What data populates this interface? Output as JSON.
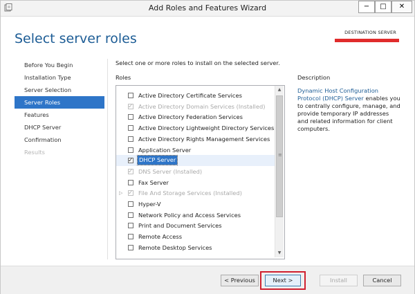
{
  "window": {
    "title": "Add Roles and Features Wizard",
    "controls": {
      "minimize": "−",
      "maximize": "□",
      "close": "✕"
    }
  },
  "page": {
    "heading": "Select server roles",
    "destination_label": "DESTINATION SERVER"
  },
  "nav": {
    "items": [
      {
        "label": "Before You Begin",
        "state": "normal"
      },
      {
        "label": "Installation Type",
        "state": "normal"
      },
      {
        "label": "Server Selection",
        "state": "normal"
      },
      {
        "label": "Server Roles",
        "state": "active"
      },
      {
        "label": "Features",
        "state": "normal"
      },
      {
        "label": "DHCP Server",
        "state": "normal"
      },
      {
        "label": "Confirmation",
        "state": "normal"
      },
      {
        "label": "Results",
        "state": "disabled"
      }
    ]
  },
  "main": {
    "instruction": "Select one or more roles to install on the selected server.",
    "roles_label": "Roles",
    "roles": [
      {
        "label": "Active Directory Certificate Services",
        "checked": false,
        "disabled": false,
        "expandable": false,
        "selected": false
      },
      {
        "label": "Active Directory Domain Services (Installed)",
        "checked": true,
        "disabled": true,
        "expandable": false,
        "selected": false
      },
      {
        "label": "Active Directory Federation Services",
        "checked": false,
        "disabled": false,
        "expandable": false,
        "selected": false
      },
      {
        "label": "Active Directory Lightweight Directory Services",
        "checked": false,
        "disabled": false,
        "expandable": false,
        "selected": false
      },
      {
        "label": "Active Directory Rights Management Services",
        "checked": false,
        "disabled": false,
        "expandable": false,
        "selected": false
      },
      {
        "label": "Application Server",
        "checked": false,
        "disabled": false,
        "expandable": false,
        "selected": false
      },
      {
        "label": "DHCP Server",
        "checked": true,
        "disabled": false,
        "expandable": false,
        "selected": true
      },
      {
        "label": "DNS Server (Installed)",
        "checked": true,
        "disabled": true,
        "expandable": false,
        "selected": false
      },
      {
        "label": "Fax Server",
        "checked": false,
        "disabled": false,
        "expandable": false,
        "selected": false
      },
      {
        "label": "File And Storage Services (Installed)",
        "checked": true,
        "disabled": true,
        "expandable": true,
        "selected": false
      },
      {
        "label": "Hyper-V",
        "checked": false,
        "disabled": false,
        "expandable": false,
        "selected": false
      },
      {
        "label": "Network Policy and Access Services",
        "checked": false,
        "disabled": false,
        "expandable": false,
        "selected": false
      },
      {
        "label": "Print and Document Services",
        "checked": false,
        "disabled": false,
        "expandable": false,
        "selected": false
      },
      {
        "label": "Remote Access",
        "checked": false,
        "disabled": false,
        "expandable": false,
        "selected": false
      },
      {
        "label": "Remote Desktop Services",
        "checked": false,
        "disabled": false,
        "expandable": false,
        "selected": false
      }
    ]
  },
  "description": {
    "heading": "Description",
    "link_text": "Dynamic Host Configuration Protocol (DHCP) Server",
    "body": " enables you to centrally configure, manage, and provide temporary IP addresses and related information for client computers."
  },
  "footer": {
    "previous": "< Previous",
    "next": "Next >",
    "install": "Install",
    "cancel": "Cancel"
  },
  "colors": {
    "heading": "#1c5c95",
    "active_nav": "#2e75c8",
    "highlight": "#d0202f"
  }
}
